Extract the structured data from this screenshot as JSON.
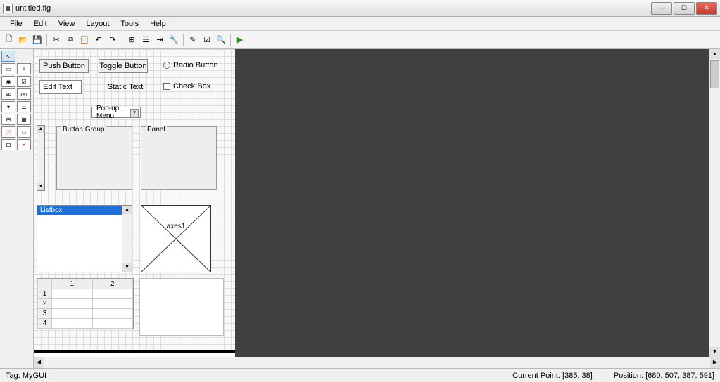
{
  "window": {
    "title": "untitled.fig"
  },
  "menu": {
    "items": [
      "File",
      "Edit",
      "View",
      "Layout",
      "Tools",
      "Help"
    ]
  },
  "canvas": {
    "pushbutton": "Push Button",
    "togglebutton": "Toggle Button",
    "radiobutton": "Radio Button",
    "edittext": "Edit Text",
    "statictext": "Static Text",
    "checkbox": "Check Box",
    "popup": "Pop-up Menu",
    "buttongroup": "Button Group",
    "panel": "Panel",
    "listbox_item": "Listbox",
    "axes_label": "axes1",
    "table": {
      "cols": [
        "1",
        "2"
      ],
      "rows": [
        "1",
        "2",
        "3",
        "4"
      ]
    }
  },
  "status": {
    "tag_label": "Tag:",
    "tag_value": "MyGUI",
    "cp_label": "Current Point:",
    "cp_value": "[385, 38]",
    "pos_label": "Position:",
    "pos_value": "[680, 507, 387, 591]"
  }
}
